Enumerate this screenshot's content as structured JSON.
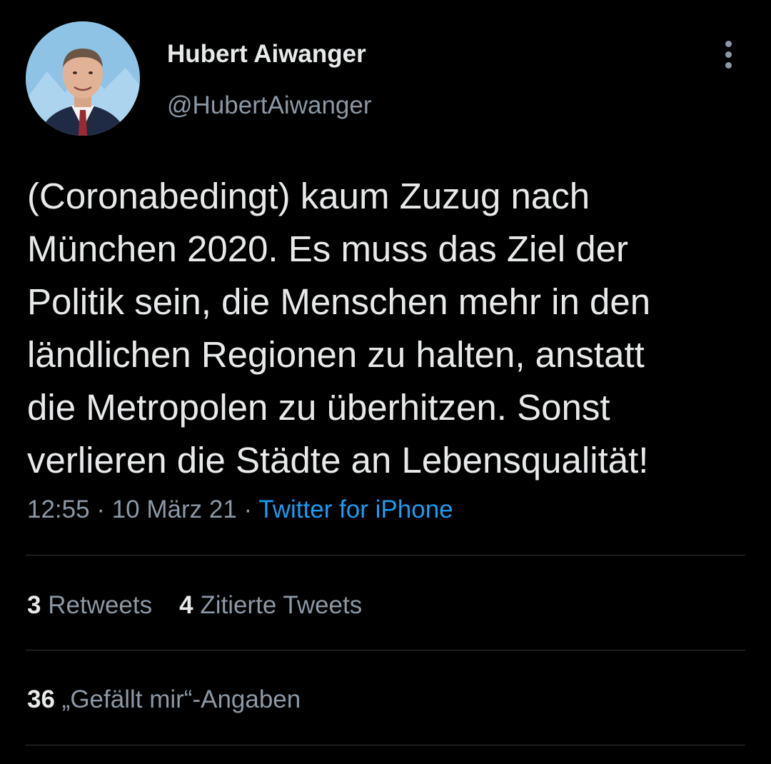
{
  "author": {
    "display_name": "Hubert Aiwanger",
    "handle": "@HubertAiwanger",
    "avatar_icon": "profile-photo"
  },
  "menu": {
    "icon": "more-vertical-icon"
  },
  "tweet": {
    "text": "(Coronabedingt) kaum Zuzug nach\nMünchen 2020. Es muss das Ziel der\nPolitik sein, die Menschen mehr in den\nländlichen Regionen zu halten, anstatt\ndie Metropolen zu überhitzen. Sonst\nverlieren die Städte an Lebensqualität!"
  },
  "meta": {
    "time": "12:55",
    "separator": " · ",
    "date": "10 März 21",
    "source": "Twitter for iPhone"
  },
  "stats": {
    "retweets_count": "3",
    "retweets_label": "Retweets",
    "quotes_count": "4",
    "quotes_label": "Zitierte Tweets",
    "likes_count": "36",
    "likes_label": "„Gefällt mir“-Angaben"
  },
  "colors": {
    "background": "#000000",
    "primary_text": "#e7e9ea",
    "secondary_text": "#8b98a5",
    "link": "#1d9bf0",
    "divider": "#2f3336"
  }
}
